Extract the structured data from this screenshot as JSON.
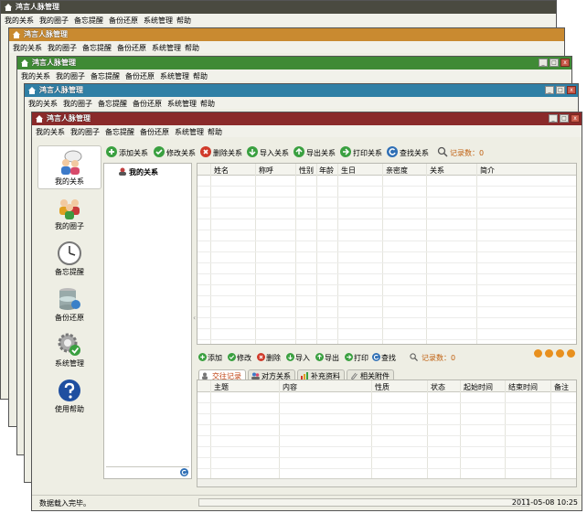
{
  "app": {
    "title": "鸿言人脉管理",
    "menu": [
      "我的关系",
      "我的圈子",
      "备忘提醒",
      "备份还原",
      "系统管理",
      "帮助"
    ],
    "window_controls": [
      "_",
      "□",
      "x"
    ]
  },
  "colors": {
    "win1": "#4a4a40",
    "win2": "#c98a30",
    "win3": "#3f8a35",
    "win4": "#2f7fa5",
    "win5": "#8a2a2a"
  },
  "sidebar": {
    "items": [
      {
        "label": "我的关系",
        "icon": "people-relation-icon"
      },
      {
        "label": "我的圈子",
        "icon": "group-circle-icon"
      },
      {
        "label": "备忘提醒",
        "icon": "clock-icon"
      },
      {
        "label": "备份还原",
        "icon": "database-backup-icon"
      },
      {
        "label": "系统管理",
        "icon": "gear-check-icon"
      },
      {
        "label": "使用帮助",
        "icon": "help-icon"
      }
    ]
  },
  "toolbar": {
    "buttons": [
      {
        "label": "添加关系",
        "icon": "add-icon"
      },
      {
        "label": "修改关系",
        "icon": "edit-icon"
      },
      {
        "label": "删除关系",
        "icon": "delete-icon"
      },
      {
        "label": "导入关系",
        "icon": "import-icon"
      },
      {
        "label": "导出关系",
        "icon": "export-icon"
      },
      {
        "label": "打印关系",
        "icon": "print-icon"
      },
      {
        "label": "查找关系",
        "icon": "find-icon"
      }
    ],
    "record_count": "记录数：0"
  },
  "tree": {
    "root": "我的关系"
  },
  "grid": {
    "columns": [
      "姓名",
      "称呼",
      "性别",
      "年龄",
      "生日",
      "亲密度",
      "关系",
      "简介"
    ]
  },
  "sub_toolbar": {
    "buttons": [
      "添加",
      "修改",
      "删除",
      "导入",
      "导出",
      "打印",
      "查找"
    ],
    "record_count": "记录数：0"
  },
  "tabs": [
    "交往记录",
    "对方关系",
    "补充资料",
    "相关附件"
  ],
  "grid2": {
    "columns": [
      "主题",
      "内容",
      "性质",
      "状态",
      "起始时间",
      "结束时间",
      "备注"
    ]
  },
  "status": {
    "message": "数据载入完毕。",
    "datetime": "2011-05-08 10:25"
  }
}
